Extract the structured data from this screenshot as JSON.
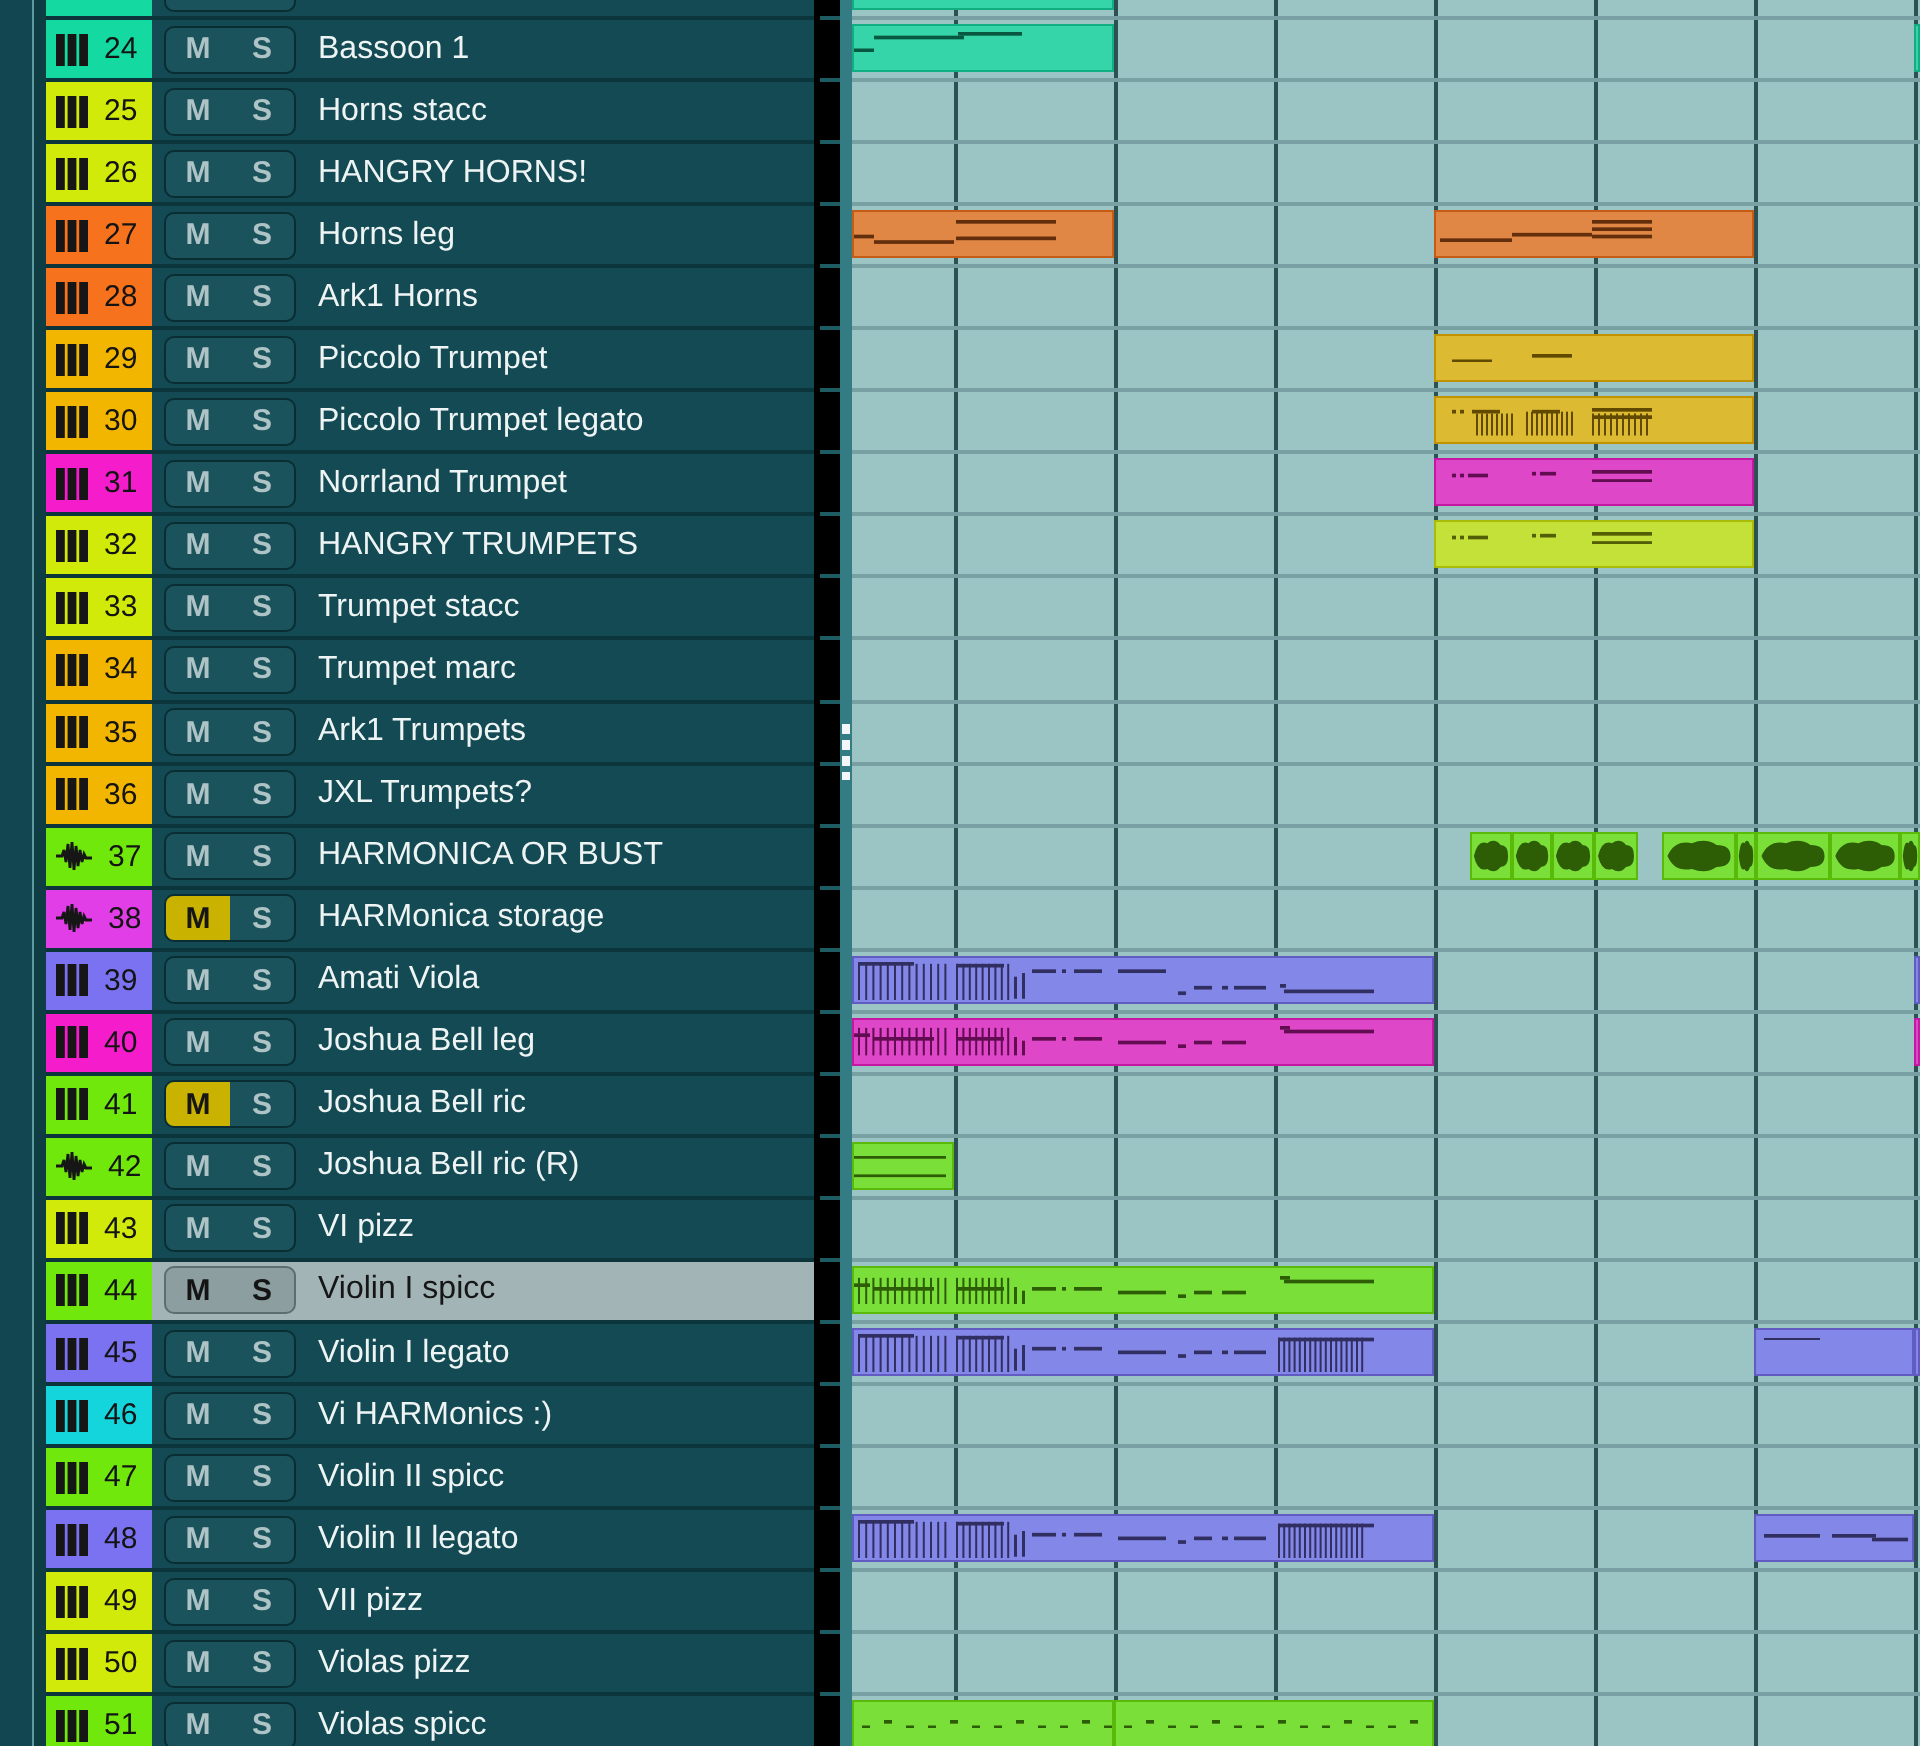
{
  "clipped_track_above": {
    "color": "#14d9a0",
    "regions": [
      {
        "kind": "midi"
      }
    ]
  },
  "tracks": [
    {
      "number": "24",
      "name": "Bassoon 1",
      "kind": "midi",
      "color": "#14d9a0",
      "mute_button": "M",
      "solo_button": "S",
      "muted": false,
      "selected": false,
      "regions": [
        {
          "kind": "midi"
        },
        {
          "kind": "midi"
        }
      ]
    },
    {
      "number": "25",
      "name": "Horns stacc",
      "kind": "midi",
      "color": "#d2ea0a",
      "mute_button": "M",
      "solo_button": "S",
      "muted": false,
      "selected": false
    },
    {
      "number": "26",
      "name": "HANGRY HORNS!",
      "kind": "midi",
      "color": "#d2ea0a",
      "mute_button": "M",
      "solo_button": "S",
      "muted": false,
      "selected": false
    },
    {
      "number": "27",
      "name": "Horns leg",
      "kind": "midi",
      "color": "#f7721c",
      "mute_button": "M",
      "solo_button": "S",
      "muted": false,
      "selected": false,
      "regions": [
        {
          "kind": "midi"
        },
        {
          "kind": "midi"
        }
      ]
    },
    {
      "number": "28",
      "name": "Ark1 Horns",
      "kind": "midi",
      "color": "#f7721c",
      "mute_button": "M",
      "solo_button": "S",
      "muted": false,
      "selected": false
    },
    {
      "number": "29",
      "name": "Piccolo Trumpet",
      "kind": "midi",
      "color": "#f2b600",
      "mute_button": "M",
      "solo_button": "S",
      "muted": false,
      "selected": false,
      "regions": [
        {
          "kind": "midi"
        }
      ]
    },
    {
      "number": "30",
      "name": "Piccolo Trumpet legato",
      "kind": "midi",
      "color": "#f2b600",
      "mute_button": "M",
      "solo_button": "S",
      "muted": false,
      "selected": false,
      "regions": [
        {
          "kind": "midi"
        }
      ]
    },
    {
      "number": "31",
      "name": "Norrland Trumpet",
      "kind": "midi",
      "color": "#f51dcb",
      "mute_button": "M",
      "solo_button": "S",
      "muted": false,
      "selected": false,
      "regions": [
        {
          "kind": "midi"
        }
      ]
    },
    {
      "number": "32",
      "name": "HANGRY TRUMPETS",
      "kind": "midi",
      "color": "#d2ea0a",
      "mute_button": "M",
      "solo_button": "S",
      "muted": false,
      "selected": false,
      "regions": [
        {
          "kind": "midi"
        }
      ]
    },
    {
      "number": "33",
      "name": "Trumpet stacc",
      "kind": "midi",
      "color": "#d2ea0a",
      "mute_button": "M",
      "solo_button": "S",
      "muted": false,
      "selected": false
    },
    {
      "number": "34",
      "name": "Trumpet marc",
      "kind": "midi",
      "color": "#f2b600",
      "mute_button": "M",
      "solo_button": "S",
      "muted": false,
      "selected": false
    },
    {
      "number": "35",
      "name": "Ark1 Trumpets",
      "kind": "midi",
      "color": "#f2b600",
      "mute_button": "M",
      "solo_button": "S",
      "muted": false,
      "selected": false
    },
    {
      "number": "36",
      "name": "JXL Trumpets?",
      "kind": "midi",
      "color": "#f2b600",
      "mute_button": "M",
      "solo_button": "S",
      "muted": false,
      "selected": false
    },
    {
      "number": "37",
      "name": "HARMONICA OR BUST",
      "kind": "audio",
      "color": "#70e80c",
      "mute_button": "M",
      "solo_button": "S",
      "muted": false,
      "selected": false,
      "regions": [
        {
          "kind": "audio"
        },
        {
          "kind": "audio"
        },
        {
          "kind": "audio"
        },
        {
          "kind": "audio"
        },
        {
          "kind": "audio"
        },
        {
          "kind": "audio"
        },
        {
          "kind": "audio"
        },
        {
          "kind": "audio"
        },
        {
          "kind": "audio"
        }
      ]
    },
    {
      "number": "38",
      "name": "HARMonica storage",
      "kind": "audio",
      "color": "#e23ee8",
      "mute_button": "M",
      "solo_button": "S",
      "muted": true,
      "selected": false
    },
    {
      "number": "39",
      "name": "Amati Viola",
      "kind": "midi",
      "color": "#7b72f2",
      "mute_button": "M",
      "solo_button": "S",
      "muted": false,
      "selected": false,
      "regions": [
        {
          "kind": "midi"
        },
        {
          "kind": "midi"
        }
      ]
    },
    {
      "number": "40",
      "name": "Joshua Bell leg",
      "kind": "midi",
      "color": "#f51dcb",
      "mute_button": "M",
      "solo_button": "S",
      "muted": false,
      "selected": false,
      "regions": [
        {
          "kind": "midi"
        },
        {
          "kind": "midi"
        }
      ]
    },
    {
      "number": "41",
      "name": "Joshua Bell ric",
      "kind": "midi",
      "color": "#70e80c",
      "mute_button": "M",
      "solo_button": "S",
      "muted": true,
      "selected": false
    },
    {
      "number": "42",
      "name": "Joshua Bell ric (R)",
      "kind": "audio",
      "color": "#70e80c",
      "mute_button": "M",
      "solo_button": "S",
      "muted": false,
      "selected": false,
      "regions": [
        {
          "kind": "audio"
        }
      ]
    },
    {
      "number": "43",
      "name": "VI pizz",
      "kind": "midi",
      "color": "#d2ea0a",
      "mute_button": "M",
      "solo_button": "S",
      "muted": false,
      "selected": false
    },
    {
      "number": "44",
      "name": "Violin I spicc",
      "kind": "midi",
      "color": "#70e80c",
      "mute_button": "M",
      "solo_button": "S",
      "muted": false,
      "selected": true,
      "regions": [
        {
          "kind": "midi"
        }
      ]
    },
    {
      "number": "45",
      "name": "Violin I legato",
      "kind": "midi",
      "color": "#7b72f2",
      "mute_button": "M",
      "solo_button": "S",
      "muted": false,
      "selected": false,
      "regions": [
        {
          "kind": "midi"
        },
        {
          "kind": "midi"
        },
        {
          "kind": "midi"
        }
      ]
    },
    {
      "number": "46",
      "name": "Vi HARMonics :)",
      "kind": "midi",
      "color": "#14d4dc",
      "mute_button": "M",
      "solo_button": "S",
      "muted": false,
      "selected": false
    },
    {
      "number": "47",
      "name": "Violin II spicc",
      "kind": "midi",
      "color": "#70e80c",
      "mute_button": "M",
      "solo_button": "S",
      "muted": false,
      "selected": false
    },
    {
      "number": "48",
      "name": "Violin II legato",
      "kind": "midi",
      "color": "#7b72f2",
      "mute_button": "M",
      "solo_button": "S",
      "muted": false,
      "selected": false,
      "regions": [
        {
          "kind": "midi"
        },
        {
          "kind": "midi"
        }
      ]
    },
    {
      "number": "49",
      "name": "VII pizz",
      "kind": "midi",
      "color": "#d2ea0a",
      "mute_button": "M",
      "solo_button": "S",
      "muted": false,
      "selected": false
    },
    {
      "number": "50",
      "name": "Violas pizz",
      "kind": "midi",
      "color": "#d2ea0a",
      "mute_button": "M",
      "solo_button": "S",
      "muted": false,
      "selected": false
    },
    {
      "number": "51",
      "name": "Violas spicc",
      "kind": "midi",
      "color": "#70e80c",
      "mute_button": "M",
      "solo_button": "S",
      "muted": false,
      "selected": false,
      "regions": [
        {
          "kind": "midi"
        },
        {
          "kind": "midi"
        }
      ]
    }
  ]
}
